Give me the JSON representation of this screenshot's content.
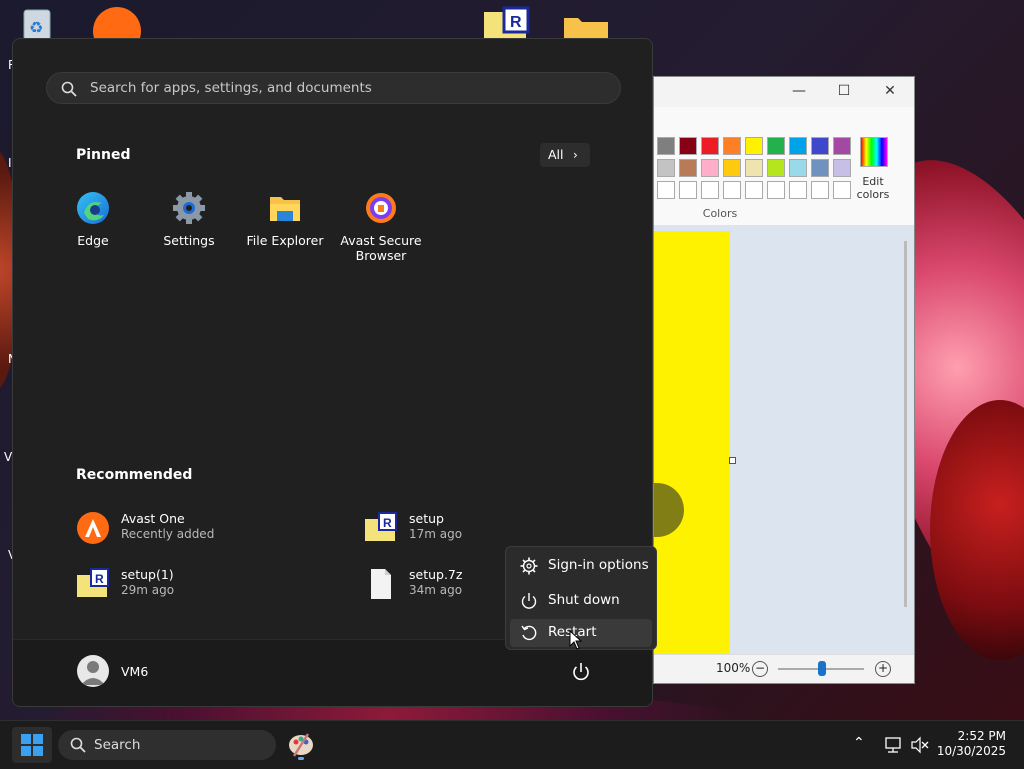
{
  "desktop": {
    "left_edge_letters": [
      "R",
      "I",
      "N",
      "V",
      "V"
    ]
  },
  "paint": {
    "colors_label": "Colors",
    "edit_colors_label": "Edit colors",
    "zoom_label": "100%",
    "palette_row1": [
      "#7f7f7f",
      "#880015",
      "#ed1c24",
      "#ff7f27",
      "#fff200",
      "#22b14c",
      "#00a2e8",
      "#3f48cc",
      "#a349a4"
    ],
    "palette_row2": [
      "#c3c3c3",
      "#b97a57",
      "#ffaec9",
      "#ffc90e",
      "#efe4b0",
      "#b5e61d",
      "#99d9ea",
      "#7092be",
      "#c8bfe7"
    ]
  },
  "start_menu": {
    "search_placeholder": "Search for apps, settings, and documents",
    "pinned_title": "Pinned",
    "all_button": "All",
    "pinned": [
      {
        "label": "Edge",
        "icon": "edge-icon"
      },
      {
        "label": "Settings",
        "icon": "settings-gear-icon"
      },
      {
        "label": "File Explorer",
        "icon": "folder-icon"
      },
      {
        "label": "Avast Secure Browser",
        "icon": "avast-browser-icon"
      }
    ],
    "recommended_title": "Recommended",
    "recommended": [
      {
        "name": "Avast One",
        "detail": "Recently added",
        "icon": "avast-one-icon"
      },
      {
        "name": "setup",
        "detail": "17m ago",
        "icon": "setup-folder-icon"
      },
      {
        "name": "setup(1)",
        "detail": "29m ago",
        "icon": "setup-folder-icon"
      },
      {
        "name": "setup.7z",
        "detail": "34m ago",
        "icon": "file-icon"
      }
    ],
    "user_name": "VM6"
  },
  "power_menu": {
    "items": [
      {
        "label": "Sign-in options",
        "icon": "gear-icon"
      },
      {
        "label": "Shut down",
        "icon": "power-icon"
      },
      {
        "label": "Restart",
        "icon": "restart-icon"
      }
    ]
  },
  "taskbar": {
    "search_label": "Search",
    "time": "2:52 PM",
    "date": "10/30/2025"
  }
}
